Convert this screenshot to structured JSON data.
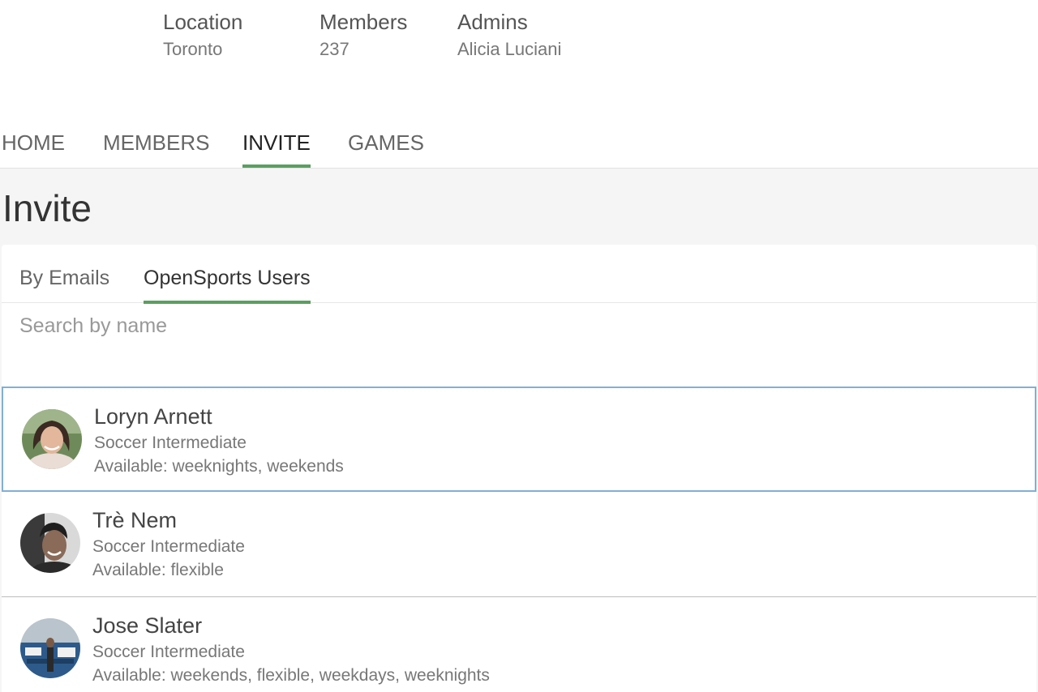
{
  "group_info": {
    "location": {
      "label": "Location",
      "value": "Toronto"
    },
    "members": {
      "label": "Members",
      "value": "237"
    },
    "admins": {
      "label": "Admins",
      "value": "Alicia Luciani"
    }
  },
  "main_nav": {
    "tabs": [
      {
        "label": "HOME",
        "active": false
      },
      {
        "label": "MEMBERS",
        "active": false
      },
      {
        "label": "INVITE",
        "active": true
      },
      {
        "label": "GAMES",
        "active": false
      }
    ]
  },
  "page": {
    "title": "Invite"
  },
  "invite": {
    "sub_tabs": [
      {
        "label": "By Emails",
        "active": false
      },
      {
        "label": "OpenSports Users",
        "active": true
      }
    ],
    "search": {
      "placeholder": "Search by name",
      "value": ""
    },
    "users": [
      {
        "name": "Loryn Arnett",
        "level": "Soccer Intermediate",
        "availability": "Available: weeknights, weekends",
        "selected": true
      },
      {
        "name": "Trè Nem",
        "level": "Soccer Intermediate",
        "availability": "Available: flexible",
        "selected": false
      },
      {
        "name": "Jose Slater",
        "level": "Soccer Intermediate",
        "availability": "Available: weekends, flexible, weekdays, weeknights",
        "selected": false
      }
    ]
  },
  "colors": {
    "accent_green": "#5a9f5f",
    "selected_border": "#7fb0d6",
    "page_background": "#f5f5f5"
  }
}
